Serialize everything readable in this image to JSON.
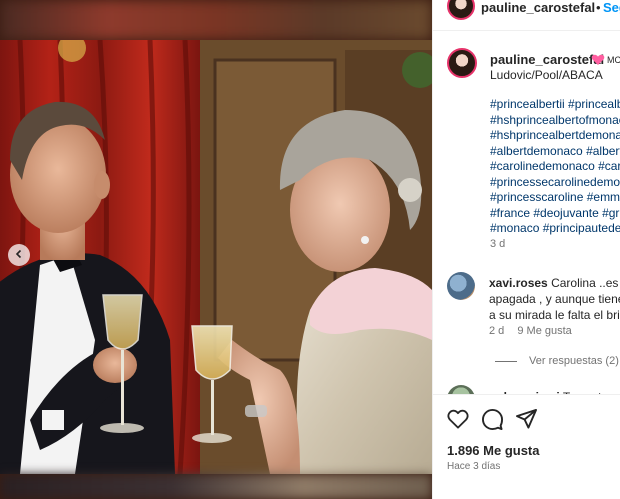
{
  "header": {
    "username": "pauline_carostefal",
    "separator": "•",
    "follow_label": "Segu"
  },
  "caption": {
    "username": "pauline_carostefal",
    "emoji_badge": "MC",
    "credit": "Ludovic/Pool/ABACA",
    "hashtags": [
      "#princealbertii #princealb",
      "#hshprincealbertofmonac",
      "#hshprincealbertdemona",
      "#albertdemonaco #albert",
      "#carolinedemonaco #caro",
      "#princessecarolinedemon",
      "#princesscaroline #emma",
      "#france #deojuvante #gri",
      "#monaco #principautede"
    ],
    "time": "3 d"
  },
  "comments": [
    {
      "username": "xavi.roses",
      "lines": [
        "Carolina ..es el",
        "apagada , y aunque tiene",
        "a su mirada le falta el bril"
      ],
      "time": "2 d",
      "likes": "9 Me gusta",
      "replies_label": "Ver respuestas (2)"
    },
    {
      "username": "nolamariami",
      "text": "Tan estupen"
    }
  ],
  "footer": {
    "likes": "1.896 Me gusta",
    "ago": "Hace 3 días"
  },
  "icons": {
    "like": "heart-icon",
    "comment": "comment-icon",
    "share": "paper-plane-icon",
    "prev": "chevron-left-icon"
  },
  "colors": {
    "link": "#00376b",
    "accent": "#0095f6",
    "muted": "#737373"
  }
}
